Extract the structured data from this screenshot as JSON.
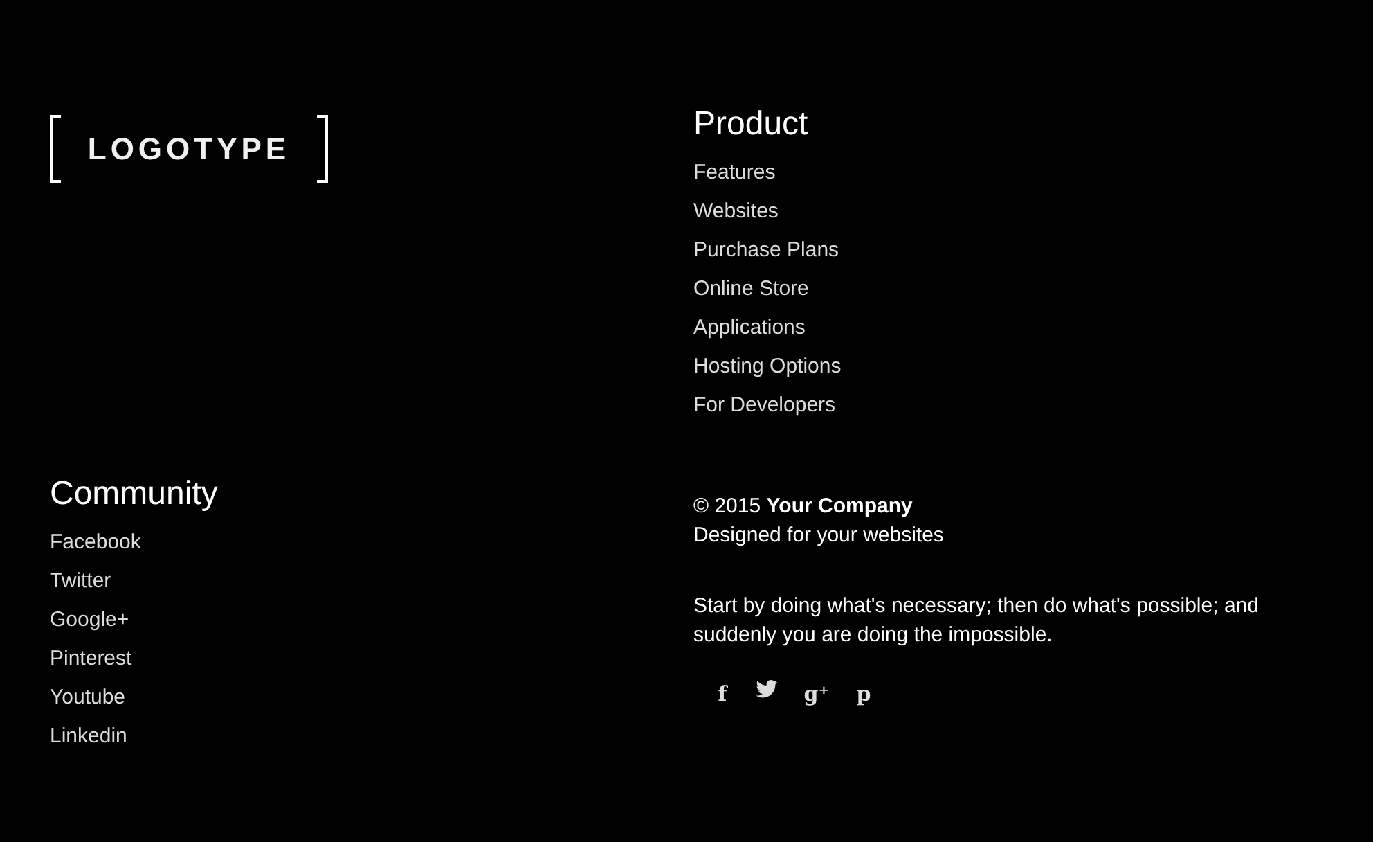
{
  "logo": {
    "text": "LOGOTYPE"
  },
  "product": {
    "heading": "Product",
    "links": [
      "Features",
      "Websites",
      "Purchase Plans",
      "Online Store",
      "Applications",
      "Hosting Options",
      "For Developers"
    ]
  },
  "community": {
    "heading": "Community",
    "links": [
      "Facebook",
      "Twitter",
      "Google+",
      "Pinterest",
      "Youtube",
      "Linkedin"
    ]
  },
  "copyright": "© 2015 **Your Company**",
  "tagline": "Designed for your websites",
  "quote": "Start by doing what's necessary; then do what's possible; and suddenly you are doing the impossible.",
  "social": [
    {
      "kind": "glyph",
      "text": "f"
    },
    {
      "kind": "bird"
    },
    {
      "kind": "glyph",
      "text": "g⁺"
    },
    {
      "kind": "glyph",
      "text": "p"
    }
  ]
}
